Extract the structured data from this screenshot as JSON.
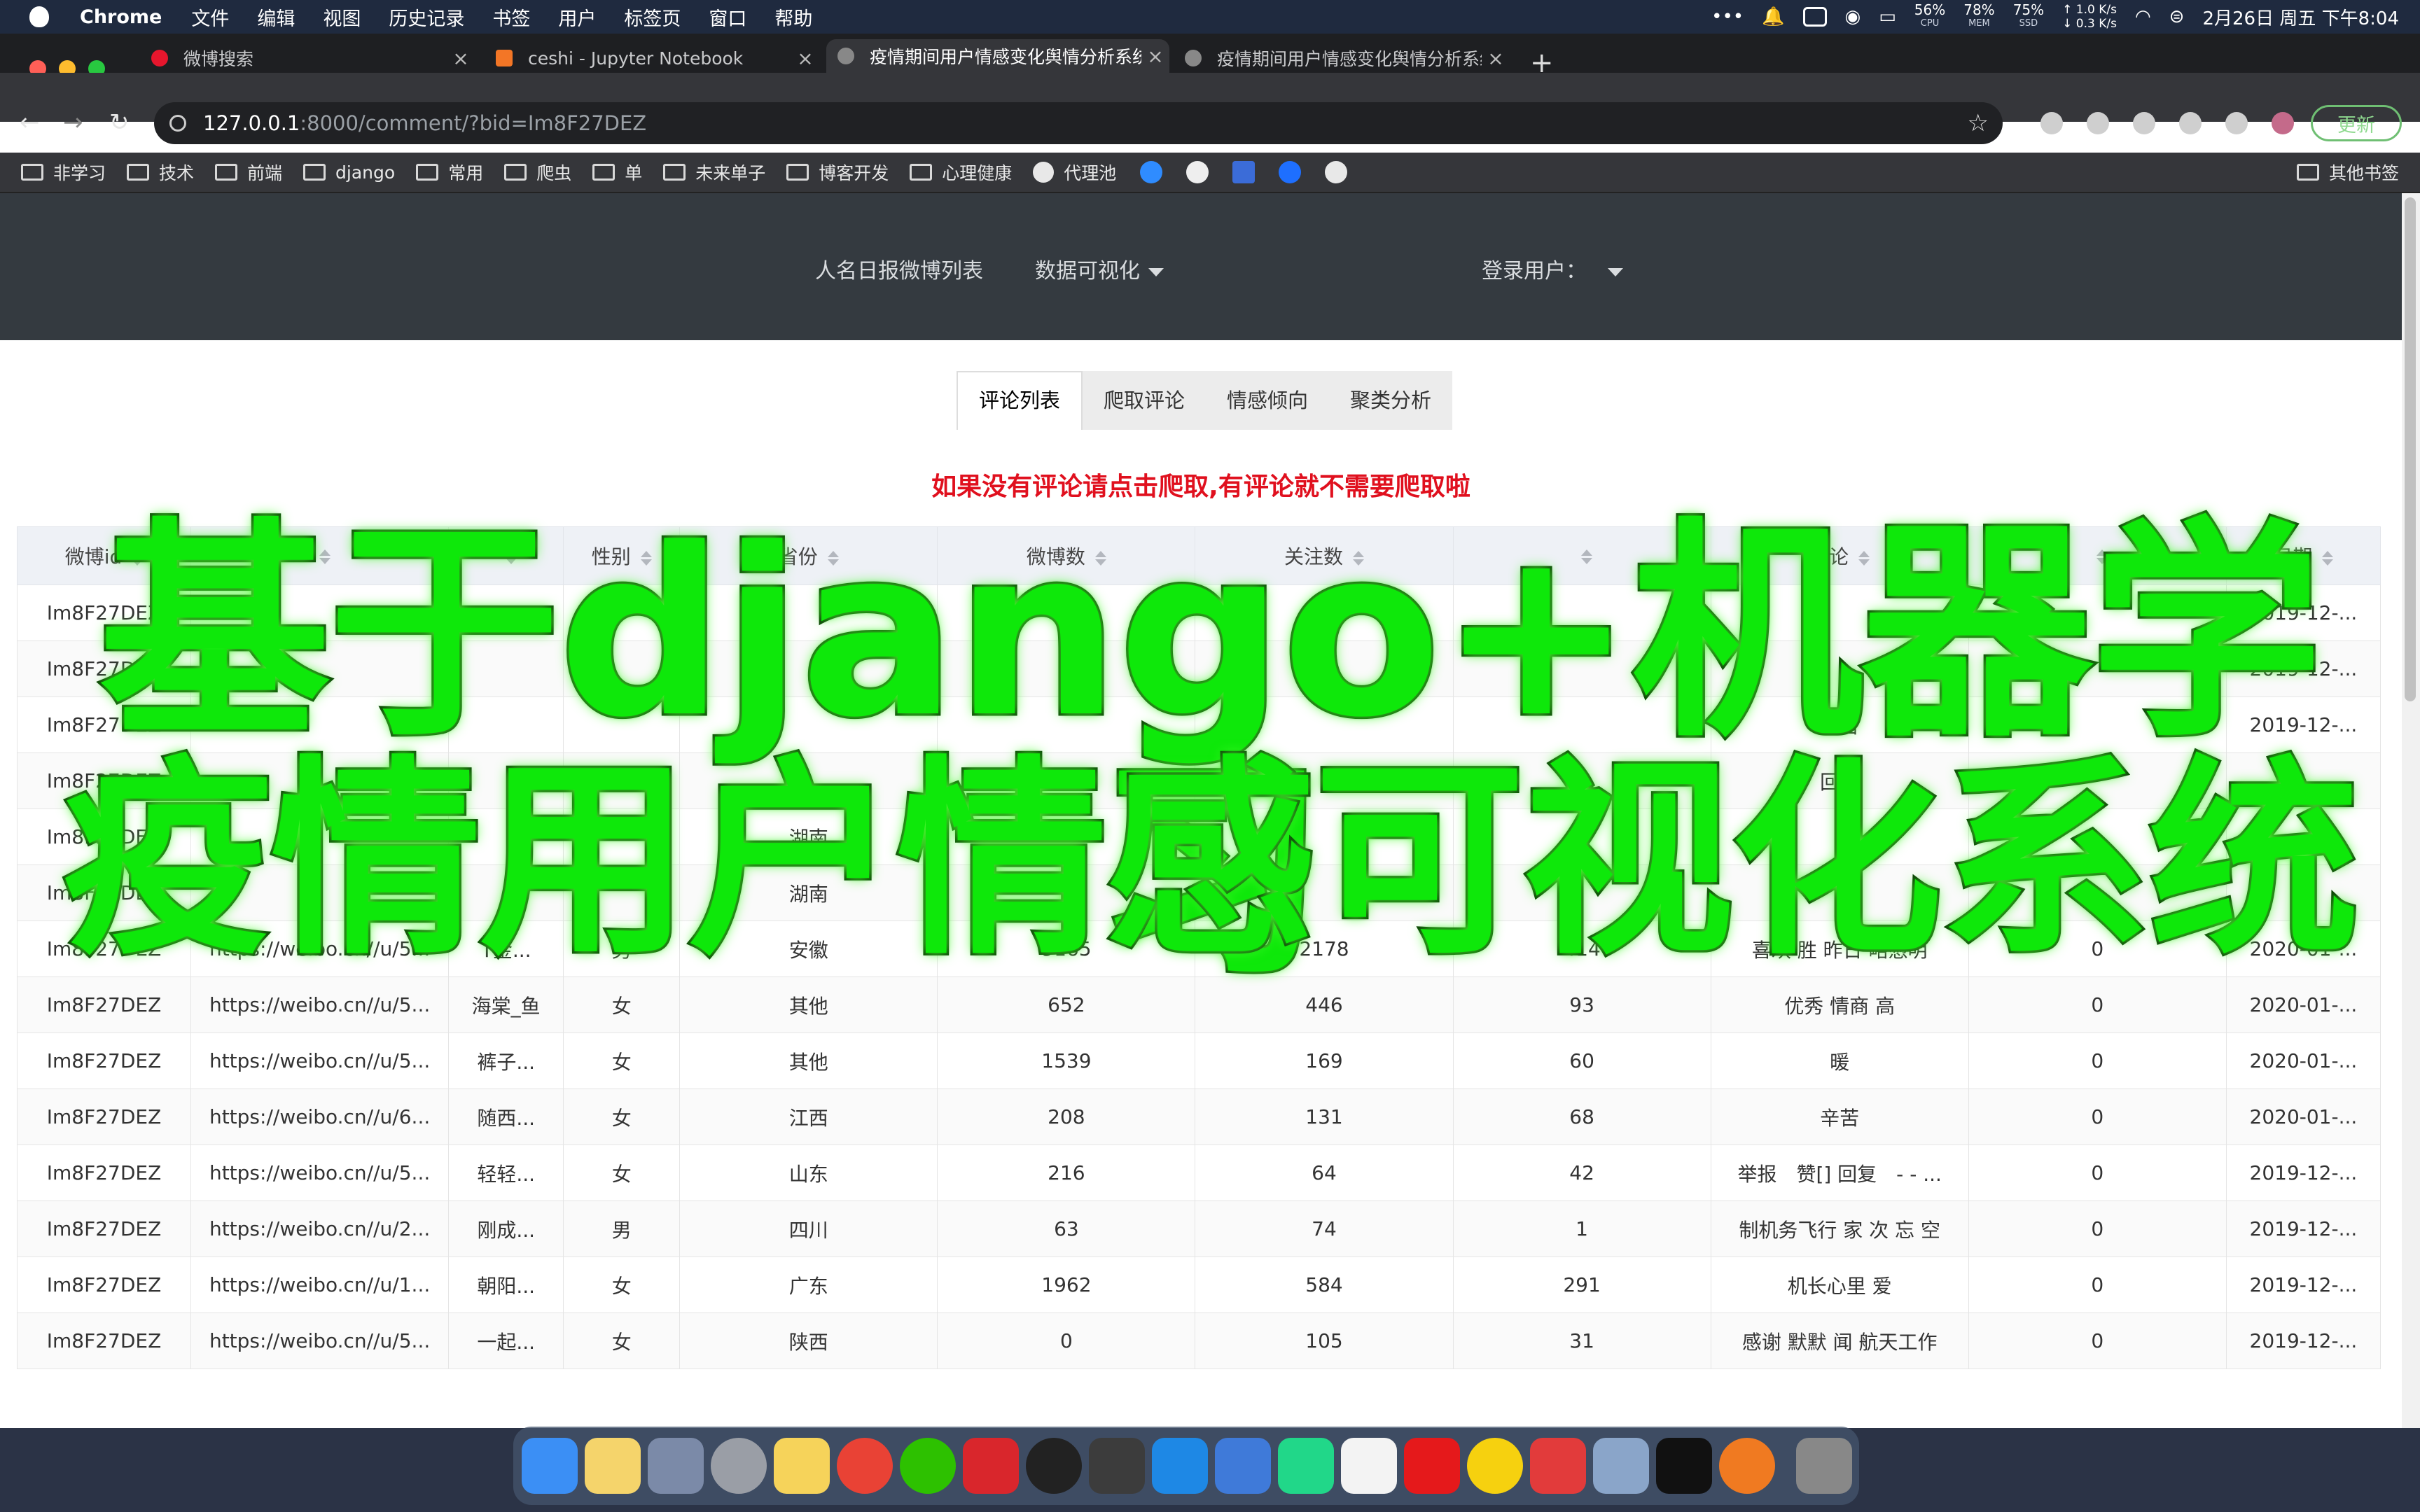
{
  "menubar": {
    "app": "Chrome",
    "items": [
      "文件",
      "编辑",
      "视图",
      "历史记录",
      "书签",
      "用户",
      "标签页",
      "窗口",
      "帮助"
    ],
    "cpu": "56%",
    "cpu_label": "CPU",
    "mem": "78%",
    "mem_label": "MEM",
    "ssd": "75%",
    "ssd_label": "SSD",
    "net_up": "↑ 1.0 K/s",
    "net_down": "↓ 0.3 K/s",
    "datetime": "2月26日 周五 下午8:04"
  },
  "tabs": [
    {
      "label": "微博搜索"
    },
    {
      "label": "ceshi - Jupyter Notebook"
    },
    {
      "label": "疫情期间用户情感变化舆情分析系统"
    },
    {
      "label": "疫情期间用户情感变化舆情分析系统"
    }
  ],
  "address": {
    "host": "127.0.0.1",
    "rest": ":8000/comment/?bid=Im8F27DEZ"
  },
  "update_label": "更新",
  "bookmarks": [
    "非学习",
    "技术",
    "前端",
    "django",
    "常用",
    "爬虫",
    "单",
    "未来单子",
    "博客开发",
    "心理健康",
    "代理池"
  ],
  "other_bookmarks": "其他书签",
  "site_nav": {
    "item1": "人名日报微博列表",
    "item2": "数据可视化",
    "user": "登录用户："
  },
  "page_tabs": [
    "评论列表",
    "爬取评论",
    "情感倾向",
    "聚类分析"
  ],
  "notice": "如果没有评论请点击爬取,有评论就不需要爬取啦",
  "table": {
    "headers": [
      "微博id",
      "",
      "",
      "性别",
      "省份",
      "微博数",
      "关注数",
      "",
      "评论",
      "",
      "日期"
    ],
    "rows": [
      [
        "Im8F27DEZ",
        "",
        "",
        "",
        "",
        "",
        "",
        "",
        "",
        "",
        "2019-12-..."
      ],
      [
        "Im8F27DEZ",
        "",
        "",
        "",
        "",
        "",
        "",
        "",
        "",
        "",
        "2019-12-..."
      ],
      [
        "Im8F27DEZ",
        "",
        "",
        "",
        "",
        "",
        "",
        "",
        "辛苦",
        "",
        "2019-12-..."
      ],
      [
        "Im8F27DEZ",
        "",
        "",
        "",
        "",
        "",
        "",
        "",
        "回复",
        "",
        ""
      ],
      [
        "Im8F27DEZ",
        "",
        "",
        "",
        "湖南",
        "",
        "",
        "",
        "",
        "",
        ""
      ],
      [
        "Im8F27DEZ",
        "",
        "",
        "",
        "湖南",
        "",
        "",
        "",
        "",
        "",
        ""
      ],
      [
        "Im8F27DEZ",
        "https://weibo.cn//u/5...",
        "T金...",
        "男",
        "安徽",
        "9165",
        "2178",
        "414",
        "喜欢 胜 昨日 略憑明",
        "0",
        "2020-01-..."
      ],
      [
        "Im8F27DEZ",
        "https://weibo.cn//u/5...",
        "海棠_鱼",
        "女",
        "其他",
        "652",
        "446",
        "93",
        "优秀 情商 高",
        "0",
        "2020-01-..."
      ],
      [
        "Im8F27DEZ",
        "https://weibo.cn//u/5...",
        "裤子...",
        "女",
        "其他",
        "1539",
        "169",
        "60",
        "暖",
        "0",
        "2020-01-..."
      ],
      [
        "Im8F27DEZ",
        "https://weibo.cn//u/6...",
        "随西...",
        "女",
        "江西",
        "208",
        "131",
        "68",
        "辛苦",
        "0",
        "2020-01-..."
      ],
      [
        "Im8F27DEZ",
        "https://weibo.cn//u/5...",
        "轻轻...",
        "女",
        "山东",
        "216",
        "64",
        "42",
        "举报　赞[] 回复　- - ...",
        "0",
        "2019-12-..."
      ],
      [
        "Im8F27DEZ",
        "https://weibo.cn//u/2...",
        "刚成...",
        "男",
        "四川",
        "63",
        "74",
        "1",
        "制机务飞行 家 次 忘 空",
        "0",
        "2019-12-..."
      ],
      [
        "Im8F27DEZ",
        "https://weibo.cn//u/1...",
        "朝阳...",
        "女",
        "广东",
        "1962",
        "584",
        "291",
        "机长心里 爱",
        "0",
        "2019-12-..."
      ],
      [
        "Im8F27DEZ",
        "https://weibo.cn//u/5...",
        "一起...",
        "女",
        "陕西",
        "0",
        "105",
        "31",
        "感谢 默默 闻 航天工作",
        "0",
        "2019-12-..."
      ]
    ]
  },
  "overlay": {
    "line1": "基于django+机器学习",
    "line2": "疫情用户情感可视化系统"
  },
  "colors": {
    "overlay_green": "#0ee80a",
    "notice_red": "#e0101e",
    "navbar": "#343a40"
  }
}
